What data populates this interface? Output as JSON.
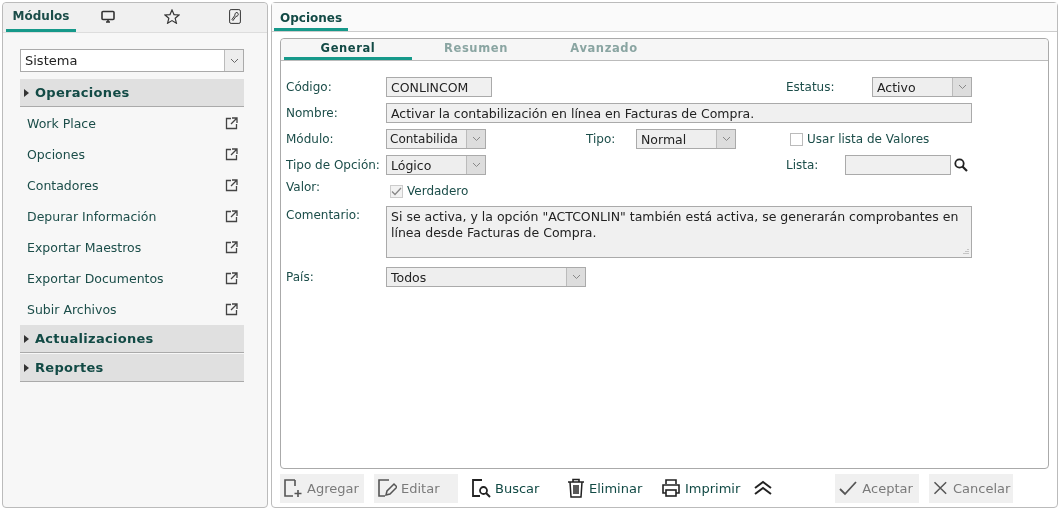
{
  "sidebar": {
    "tabs": [
      {
        "kind": "text",
        "label": "Módulos",
        "selected": true
      },
      {
        "kind": "monitor",
        "selected": false
      },
      {
        "kind": "star",
        "selected": false
      },
      {
        "kind": "wrench",
        "selected": false
      }
    ],
    "module_select": {
      "value": "Sistema"
    },
    "groups": [
      {
        "label": "Operaciones",
        "items": [
          "Work Place",
          "Opciones",
          "Contadores",
          "Depurar Información",
          "Exportar Maestros",
          "Exportar Documentos",
          "Subir Archivos"
        ]
      },
      {
        "label": "Actualizaciones"
      },
      {
        "label": "Reportes"
      }
    ]
  },
  "main_tab": {
    "label": "Opciones"
  },
  "sub_tabs": [
    {
      "label": "General",
      "selected": true
    },
    {
      "label": "Resumen",
      "selected": false
    },
    {
      "label": "Avanzado",
      "selected": false
    }
  ],
  "form": {
    "codigo": {
      "label": "Código:",
      "value": "CONLINCOM"
    },
    "estatus": {
      "label": "Estatus:",
      "value": "Activo"
    },
    "nombre": {
      "label": "Nombre:",
      "value": "Activar la contabilización en línea en Facturas de Compra."
    },
    "modulo": {
      "label": "Módulo:",
      "value": "Contabilida"
    },
    "tipo": {
      "label": "Tipo:",
      "value": "Normal"
    },
    "usar_lista": {
      "label": "Usar lista de Valores",
      "checked": false,
      "disabled": false
    },
    "tipo_opcion": {
      "label": "Tipo de Opción:",
      "value": "Lógico"
    },
    "lista": {
      "label": "Lista:"
    },
    "valor": {
      "label": "Valor:",
      "option": "Verdadero",
      "checked": true,
      "disabled": true
    },
    "comentario": {
      "label": "Comentario:",
      "value": "Si se activa, y la opción \"ACTCONLIN\" también está activa, se generarán comprobantes en línea desde Facturas de Compra."
    },
    "pais": {
      "label": "País:",
      "value": "Todos"
    }
  },
  "toolbar": [
    {
      "kind": "add",
      "label": "Agregar",
      "disabled": true
    },
    {
      "kind": "edit",
      "label": "Editar",
      "disabled": true
    },
    {
      "kind": "search",
      "label": "Buscar",
      "disabled": false
    },
    {
      "kind": "delete",
      "label": "Eliminar",
      "disabled": false
    },
    {
      "kind": "print",
      "label": "Imprimir",
      "disabled": false
    },
    {
      "kind": "collapse"
    },
    {
      "kind": "accept",
      "label": "Aceptar",
      "disabled": true
    },
    {
      "kind": "cancel",
      "label": "Cancelar",
      "disabled": true
    }
  ]
}
